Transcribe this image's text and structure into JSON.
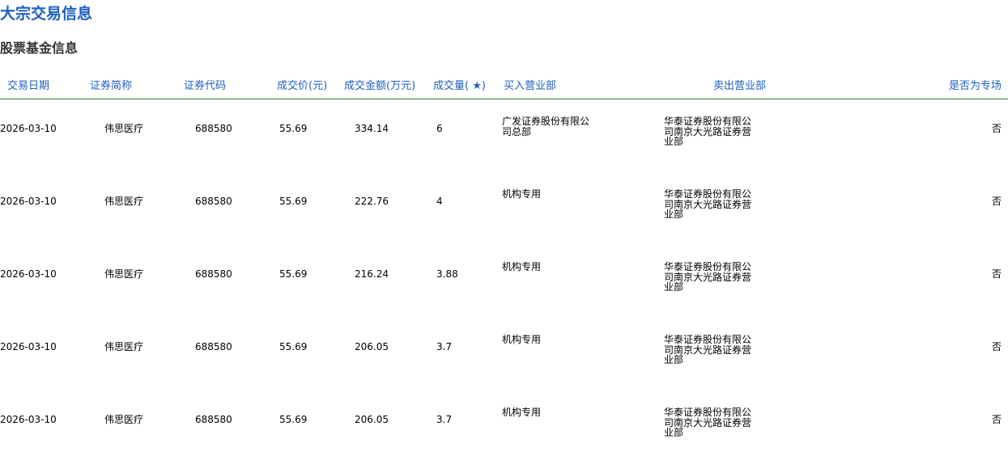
{
  "page": {
    "title": "大宗交易信息",
    "section_title": "股票基金信息"
  },
  "table": {
    "headers": {
      "trade_date": "交易日期",
      "security_name": "证券简称",
      "security_code": "证券代码",
      "price": "成交价(元)",
      "amount": "成交金额(万元)",
      "volume": "成交量( ★)",
      "buyer": "买入营业部",
      "seller": "卖出营业部",
      "is_special": "是否为专场"
    },
    "rows": [
      {
        "trade_date": "2026-03-10",
        "security_name": "伟思医疗",
        "security_code": "688580",
        "price": "55.69",
        "amount": "334.14",
        "volume": "6",
        "buyer": "广发证券股份有限公司总部",
        "seller": "华泰证券股份有限公司南京大光路证券营业部",
        "is_special": "否"
      },
      {
        "trade_date": "2026-03-10",
        "security_name": "伟思医疗",
        "security_code": "688580",
        "price": "55.69",
        "amount": "222.76",
        "volume": "4",
        "buyer": "机构专用",
        "seller": "华泰证券股份有限公司南京大光路证券营业部",
        "is_special": "否"
      },
      {
        "trade_date": "2026-03-10",
        "security_name": "伟思医疗",
        "security_code": "688580",
        "price": "55.69",
        "amount": "216.24",
        "volume": "3.88",
        "buyer": "机构专用",
        "seller": "华泰证券股份有限公司南京大光路证券营业部",
        "is_special": "否"
      },
      {
        "trade_date": "2026-03-10",
        "security_name": "伟思医疗",
        "security_code": "688580",
        "price": "55.69",
        "amount": "206.05",
        "volume": "3.7",
        "buyer": "机构专用",
        "seller": "华泰证券股份有限公司南京大光路证券营业部",
        "is_special": "否"
      },
      {
        "trade_date": "2026-03-10",
        "security_name": "伟思医疗",
        "security_code": "688580",
        "price": "55.69",
        "amount": "206.05",
        "volume": "3.7",
        "buyer": "机构专用",
        "seller": "华泰证券股份有限公司南京大光路证券营业部",
        "is_special": "否"
      }
    ]
  }
}
